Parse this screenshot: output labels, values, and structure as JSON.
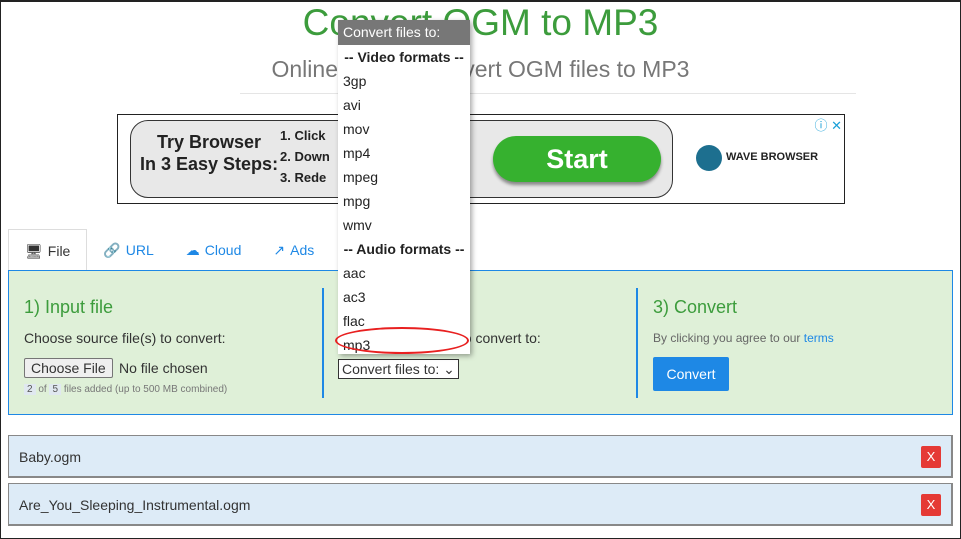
{
  "header": {
    "title": "Convert OGM to MP3",
    "subtitle": "Online & free - convert OGM files to MP3"
  },
  "ad": {
    "headline_1": "Try Browser",
    "headline_2": "In 3 Easy Steps:",
    "step1": "1. Click",
    "step2": "2. Down",
    "step3": "3. Rede",
    "cta": "Start",
    "brand": "WAVE BROWSER",
    "info_icon": "ⓘ",
    "close_icon": "✕"
  },
  "tabs": [
    {
      "label": "File",
      "icon": "monitor-icon"
    },
    {
      "label": "URL",
      "icon": "link-icon"
    },
    {
      "label": "Cloud",
      "icon": "cloud-upload-icon"
    },
    {
      "label": "Ads",
      "icon": "external-link-icon"
    }
  ],
  "panel": {
    "step1": {
      "title": "1) Input file",
      "label": "Choose source file(s) to convert:",
      "choose_button": "Choose File",
      "no_file": "No file chosen",
      "count": "2",
      "of": "of",
      "max": "5",
      "files_added": "files added (up to 500 MB combined)"
    },
    "step2": {
      "label_visible": "s to convert to:",
      "select_value": "Convert files to:"
    },
    "step3": {
      "title": "3) Convert",
      "agree": "By clicking you agree to our",
      "terms": "terms",
      "button": "Convert"
    }
  },
  "files": [
    {
      "name": "Baby.ogm",
      "remove": "X"
    },
    {
      "name": "Are_You_Sleeping_Instrumental.ogm",
      "remove": "X"
    }
  ],
  "dropdown": {
    "header": "Convert files to:",
    "video_group": "-- Video formats --",
    "video": [
      "3gp",
      "avi",
      "mov",
      "mp4",
      "mpeg",
      "mpg",
      "wmv"
    ],
    "audio_group": "-- Audio formats --",
    "audio": [
      "aac",
      "ac3",
      "flac",
      "mp3"
    ],
    "highlight_color": "#e82020"
  },
  "colors": {
    "accent": "#1e88e5",
    "title_green": "#3c9c3c",
    "panel_bg": "#dff0d8"
  }
}
